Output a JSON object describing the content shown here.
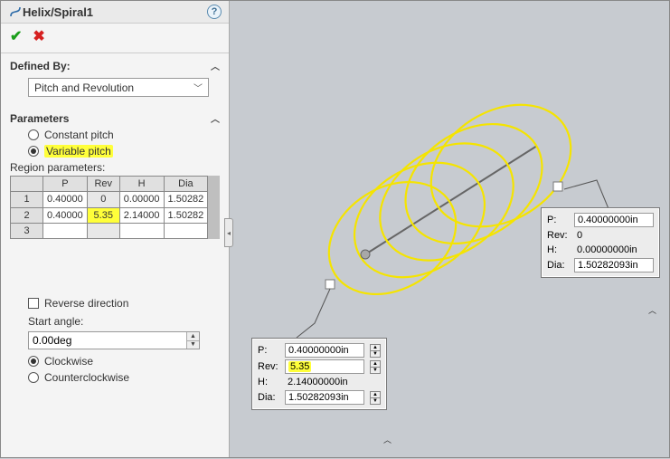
{
  "titlebar": {
    "title": "Helix/Spiral1"
  },
  "defined_by": {
    "label": "Defined By:",
    "value": "Pitch and Revolution"
  },
  "parameters": {
    "label": "Parameters",
    "pitch_constant": "Constant pitch",
    "pitch_variable": "Variable pitch",
    "region_label": "Region parameters:",
    "headers": [
      "P",
      "Rev",
      "H",
      "Dia"
    ],
    "rows": [
      {
        "idx": "1",
        "p": "0.40000",
        "rev": "0",
        "h": "0.00000",
        "dia": "1.50282"
      },
      {
        "idx": "2",
        "p": "0.40000",
        "rev": "5.35",
        "h": "2.14000",
        "dia": "1.50282"
      },
      {
        "idx": "3",
        "p": "",
        "rev": "",
        "h": "",
        "dia": ""
      }
    ],
    "reverse": "Reverse direction",
    "start_angle_label": "Start angle:",
    "start_angle_value": "0.00deg",
    "cw": "Clockwise",
    "ccw": "Counterclockwise"
  },
  "callout_end": {
    "p_label": "P:",
    "p": "0.40000000in",
    "rev_label": "Rev:",
    "rev": "5.35",
    "h_label": "H:",
    "h": "2.14000000in",
    "dia_label": "Dia:",
    "dia": "1.50282093in"
  },
  "callout_start": {
    "p_label": "P:",
    "p": "0.40000000in",
    "rev_label": "Rev:",
    "rev": "0",
    "h_label": "H:",
    "h": "0.00000000in",
    "dia_label": "Dia:",
    "dia": "1.50282093in"
  }
}
